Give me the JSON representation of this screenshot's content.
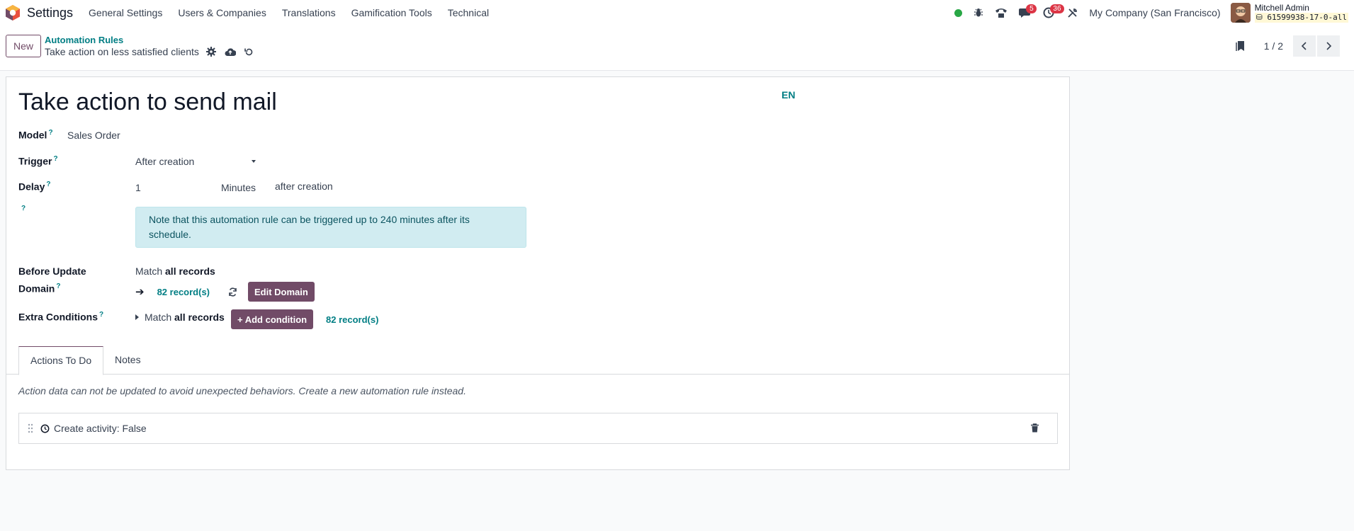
{
  "navbar": {
    "app_name": "Settings",
    "menu": [
      "General Settings",
      "Users & Companies",
      "Translations",
      "Gamification Tools",
      "Technical"
    ],
    "messages_count": "5",
    "activities_count": "36",
    "company": "My Company (San Francisco)",
    "user_name": "Mitchell Admin",
    "db_name": "61599938-17-0-all",
    "status_color": "#28a745"
  },
  "control_panel": {
    "new_label": "New",
    "breadcrumb": "Automation Rules",
    "record_name": "Take action on less satisfied clients",
    "pager": "1 / 2"
  },
  "form": {
    "title": "Take action to send mail",
    "lang": "EN",
    "model_label": "Model",
    "model_value": "Sales Order",
    "trigger_label": "Trigger",
    "trigger_value": "After creation",
    "delay_label": "Delay",
    "delay_value": "1",
    "delay_unit": "Minutes",
    "delay_suffix": "after creation",
    "help_mark": "?",
    "alert": "Note that this automation rule can be triggered up to 240 minutes after its schedule.",
    "before_update_label_1": "Before Update",
    "before_update_label_2": "Domain",
    "match_prefix": "Match",
    "match_all": "all records",
    "record_count": "82 record(s)",
    "edit_domain": "Edit Domain",
    "extra_conditions_label": "Extra Conditions",
    "add_condition": "+ Add condition"
  },
  "tabs": {
    "actions": "Actions To Do",
    "notes": "Notes"
  },
  "actions_tab": {
    "note": "Action data can not be updated to avoid unexpected behaviors. Create a new automation rule instead.",
    "rows": [
      {
        "label": "Create activity: False"
      }
    ]
  },
  "colors": {
    "primary": "#714b67",
    "link": "#017e84",
    "alert_bg": "#d1ecf1"
  }
}
